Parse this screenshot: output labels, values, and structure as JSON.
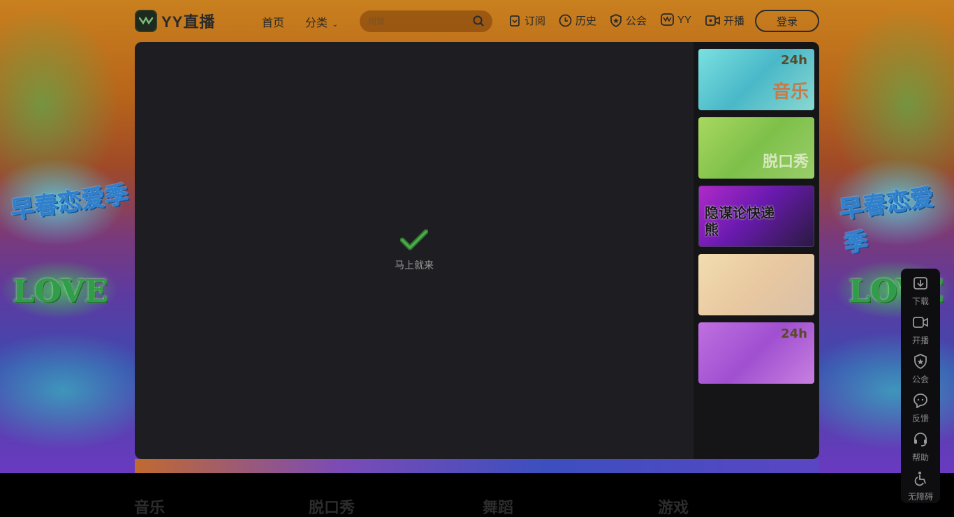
{
  "header": {
    "logo_text": "YY直播",
    "nav": {
      "home": "首页",
      "category": "分类"
    },
    "search": {
      "placeholder": "网管"
    },
    "items": {
      "subscribe": "订阅",
      "history": "历史",
      "guild": "公会",
      "yy": "YY",
      "start_live": "开播"
    },
    "login": "登录"
  },
  "background": {
    "left_title": "早春恋爱季",
    "right_title": "早春恋爱季",
    "love_text": "LOVE"
  },
  "player": {
    "loading_text": "马上就来"
  },
  "side_panel": {
    "thumbs": [
      {
        "label": "音乐",
        "badge": "24h",
        "color": "#6fd6d8"
      },
      {
        "label": "脱口秀",
        "badge": "",
        "color": "#9fd36a"
      },
      {
        "label": "隐谋论快递熊",
        "badge": "",
        "color": "#8a2ab0"
      },
      {
        "label": "",
        "badge": "",
        "color": "#e6d2a8"
      },
      {
        "label": "",
        "badge": "24h",
        "color": "#b05ad8"
      }
    ]
  },
  "float_bar": {
    "items": [
      "下载",
      "开播",
      "公会",
      "反馈",
      "帮助",
      "无障碍"
    ]
  },
  "categories": [
    "音乐",
    "脱口秀",
    "舞蹈",
    "游戏"
  ]
}
